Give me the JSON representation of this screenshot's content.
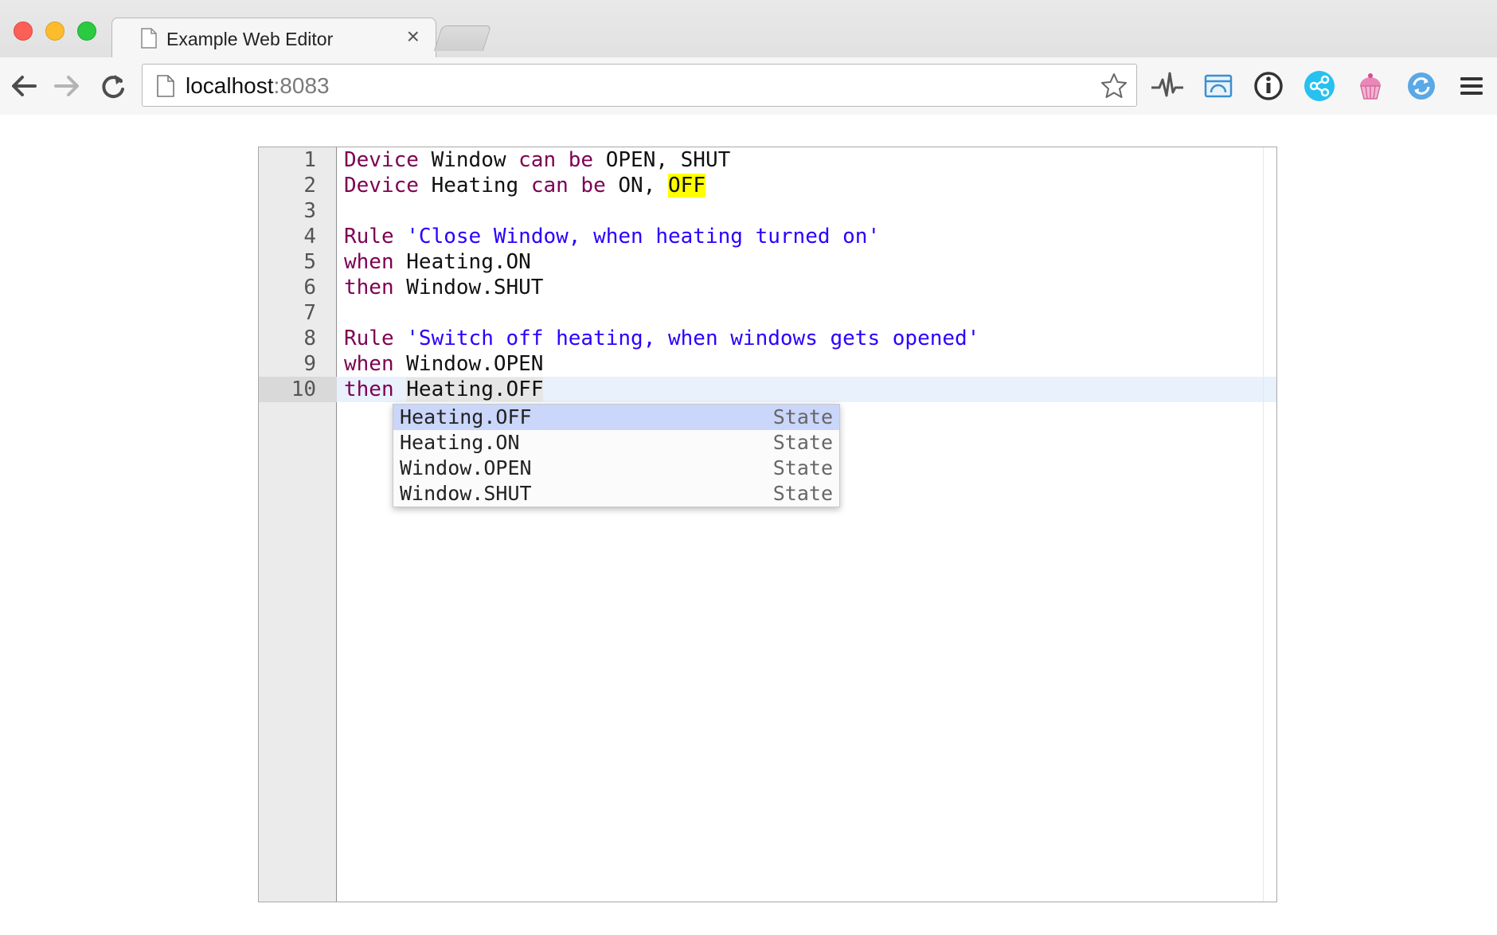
{
  "browser": {
    "tab_title": "Example Web Editor",
    "tab_close": "×",
    "url_host": "localhost",
    "url_port": ":8083",
    "icons": [
      "back-arrow-icon",
      "forward-arrow-icon",
      "reload-icon",
      "page-icon",
      "bookmark-star-icon"
    ],
    "extensions": [
      "pulse-icon",
      "window-icon",
      "info-icon",
      "share-icon",
      "cupcake-icon",
      "sync-icon",
      "menu-icon"
    ]
  },
  "editor": {
    "line_numbers": [
      "1",
      "2",
      "3",
      "4",
      "5",
      "6",
      "7",
      "8",
      "9",
      "10"
    ],
    "active_line": "10",
    "lines": [
      {
        "kw1": "Device",
        "t1": " Window ",
        "kw2": "can be",
        "t2": " OPEN, SHUT"
      },
      {
        "kw1": "Device",
        "t1": " Heating ",
        "kw2": "can be",
        "t2": " ON, ",
        "hl": "OFF"
      },
      {},
      {
        "kw1": "Rule",
        "t1": " ",
        "str": "'Close Window, when heating turned on'"
      },
      {
        "kw1": "when",
        "t1": " Heating.ON"
      },
      {
        "kw1": "then",
        "t1": " Window.SHUT"
      },
      {},
      {
        "kw1": "Rule",
        "t1": " ",
        "str": "'Switch off heating, when windows gets opened'"
      },
      {
        "kw1": "when",
        "t1": " Window.OPEN"
      },
      {
        "kw1": "then",
        "t1": " ",
        "sel": "Heating.OFF"
      }
    ]
  },
  "autocomplete": {
    "items": [
      {
        "label": "Heating.OFF",
        "type": "State"
      },
      {
        "label": "Heating.ON",
        "type": "State"
      },
      {
        "label": "Window.OPEN",
        "type": "State"
      },
      {
        "label": "Window.SHUT",
        "type": "State"
      }
    ]
  },
  "colors": {
    "keyword": "#7d0052",
    "string": "#2a00ff",
    "highlight": "#ffff00",
    "active_line": "#e8f1fc",
    "popup_selected": "#cad6fa"
  }
}
